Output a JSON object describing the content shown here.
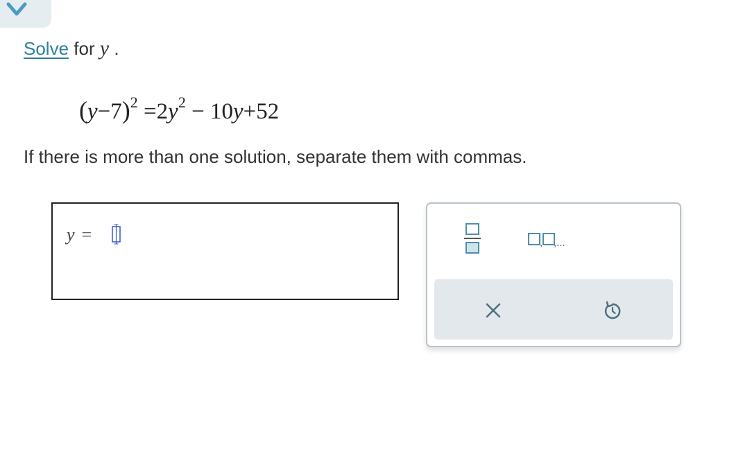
{
  "collapse_tab": {
    "icon": "chevron-down-icon"
  },
  "prompt": {
    "link_text": "Solve",
    "middle_text": "for",
    "variable": "y",
    "end_text": "."
  },
  "equation": {
    "open_paren": "(",
    "lhs_inner": "y",
    "lhs_op": "−7",
    "close_paren": ")",
    "lhs_exp": "2",
    "equals": "=",
    "rhs_coef": "2",
    "rhs_var": "y",
    "rhs_exp": "2",
    "rhs_op1": "−",
    "rhs_term2_coef": "10",
    "rhs_term2_var": "y",
    "rhs_op2": "+",
    "rhs_const": "52"
  },
  "instructions": "If there is more than one solution, separate them with commas.",
  "answer": {
    "variable": "y",
    "equals": "=",
    "value": ""
  },
  "keypad": {
    "fraction_key_icon": "fraction-template-icon",
    "list_key_icon": "comma-list-template-icon",
    "list_key_ellipsis": ",...",
    "clear_key_icon": "close-icon",
    "undo_key_icon": "undo-icon"
  },
  "colors": {
    "link": "#2e7fa1",
    "tab_bg": "#e6edf1",
    "chevron": "#4a9bc4",
    "keypad_border": "#b8c3cb",
    "action_bar_bg": "#e3e8ec",
    "key_icon": "#4d8fa8",
    "action_icon": "#4f6f7d"
  }
}
